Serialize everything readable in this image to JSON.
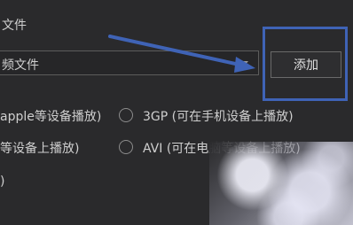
{
  "section": {
    "title": "文件"
  },
  "select": {
    "value": "频文件"
  },
  "add_button": {
    "label": "添加"
  },
  "options": [
    {
      "text": "apple等设备播放)"
    },
    {
      "text": "3GP  (可在手机设备上播放)"
    },
    {
      "text": "等设备上播放)"
    },
    {
      "text": "AVI  (可在电脑等设备上播放)"
    },
    {
      "text": ")"
    }
  ],
  "colors": {
    "annotation": "#3f63b6",
    "background": "#2a2a2c"
  },
  "icons": {
    "select_arrow": "chevron-down-icon",
    "annotation_arrow": "arrow-right-icon"
  }
}
